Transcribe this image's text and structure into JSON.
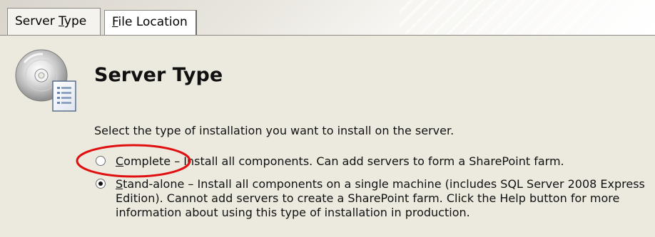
{
  "tabs": [
    {
      "label_pre": "Server ",
      "label_underline": "T",
      "label_post": "ype",
      "active": true
    },
    {
      "label_pre": "",
      "label_underline": "F",
      "label_post": "ile Location",
      "active": false
    }
  ],
  "page": {
    "title": "Server Type",
    "prompt": "Select the type of installation you want to install on the server."
  },
  "options": {
    "complete": {
      "name_underline": "C",
      "name_rest": "omplete",
      "description": " – Install all components. Can add servers to form a SharePoint farm.",
      "selected": false
    },
    "standalone": {
      "name_underline": "S",
      "name_rest": "tand-alone",
      "description": " – Install all components on a single machine (includes SQL Server 2008 Express Edition). Cannot add servers to create a SharePoint farm. Click the Help button for more information about using this type of installation in production.",
      "selected": true
    }
  },
  "annotation": {
    "highlight_color": "#e01010"
  },
  "icons": {
    "setup": "cd-with-document-icon"
  }
}
